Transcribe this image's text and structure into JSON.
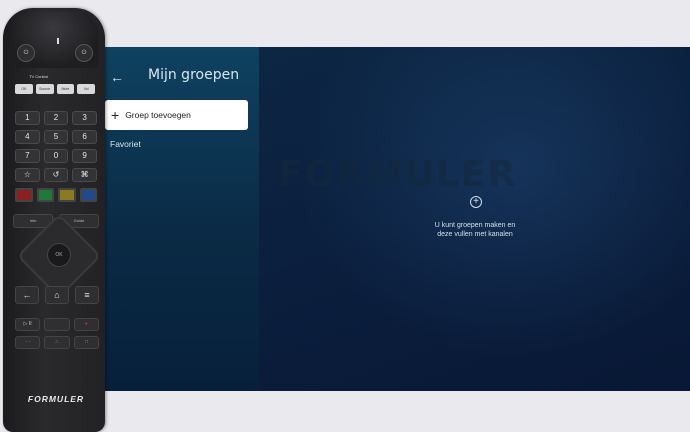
{
  "screen": {
    "back_icon": "←",
    "title": "Mijn groepen",
    "add_group_icon": "+",
    "add_group_label": "Groep toevoegen",
    "favorites_label": "Favoriet",
    "empty_icon": "+",
    "empty_line1": "U kunt groepen maken en",
    "empty_line2": "deze vullen met kanalen",
    "watermark": "FORMULER"
  },
  "remote": {
    "power_left": "⏻",
    "power_right": "⏻",
    "tv_control_label": "TV Control",
    "small_row": [
      "OK",
      "Source",
      "Mute",
      "Vol"
    ],
    "num_keys": [
      "1",
      "2",
      "3",
      "4",
      "5",
      "6",
      "7",
      "0",
      "9"
    ],
    "sub_keys": [
      "☆",
      "↺",
      "⌘"
    ],
    "mid_left": "Info",
    "mid_right": "Guide",
    "ok_label": "OK",
    "back_key": "←",
    "home_key": "⌂",
    "menu_key": "≡",
    "play_keys": [
      "▷ II",
      "",
      "●"
    ],
    "bottom_keys": [
      "· ·",
      "∴",
      "∷"
    ],
    "brand": "FORMULER",
    "colors": [
      "#8a2020",
      "#1f7a3a",
      "#8a7a20",
      "#214a8a"
    ]
  }
}
